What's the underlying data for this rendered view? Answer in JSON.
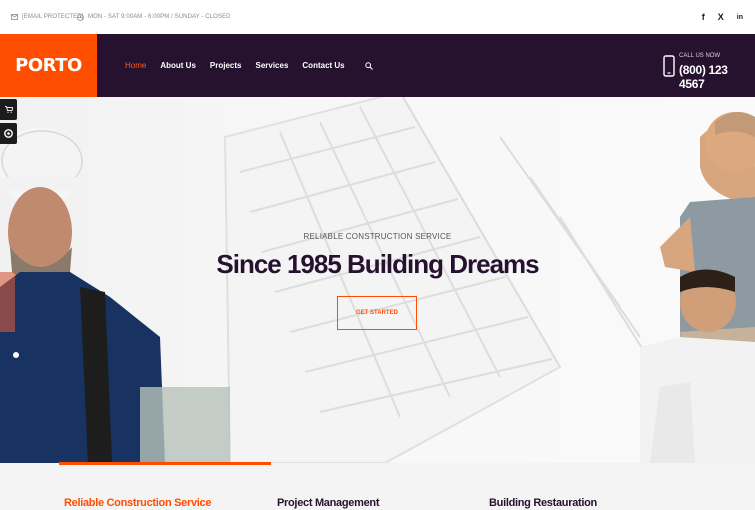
{
  "topbar": {
    "email": "[EMAIL PROTECTED]",
    "hours": "MON - SAT 9:00AM - 6:00PM / SUNDAY - CLOSED",
    "social": [
      "f",
      "X",
      "in"
    ]
  },
  "header": {
    "logo": "PORTO",
    "nav": [
      "Home",
      "About Us",
      "Projects",
      "Services",
      "Contact Us"
    ],
    "call_label": "CALL US NOW",
    "phone": "(800) 123 4567"
  },
  "hero": {
    "subtitle": "RELIABLE CONSTRUCTION SERVICE",
    "title": "Since 1985 Building Dreams",
    "button": "GET STARTED"
  },
  "services": [
    "Reliable Construction Service",
    "Project Management",
    "Building Restauration"
  ],
  "colors": {
    "accent": "#ff4e00",
    "dark": "#26112f"
  },
  "icons": [
    "mail-icon",
    "clock-icon",
    "facebook-icon",
    "x-icon",
    "linkedin-icon",
    "search-icon",
    "phone-icon",
    "gears-icon",
    "cart-icon",
    "lifebuoy-icon"
  ]
}
